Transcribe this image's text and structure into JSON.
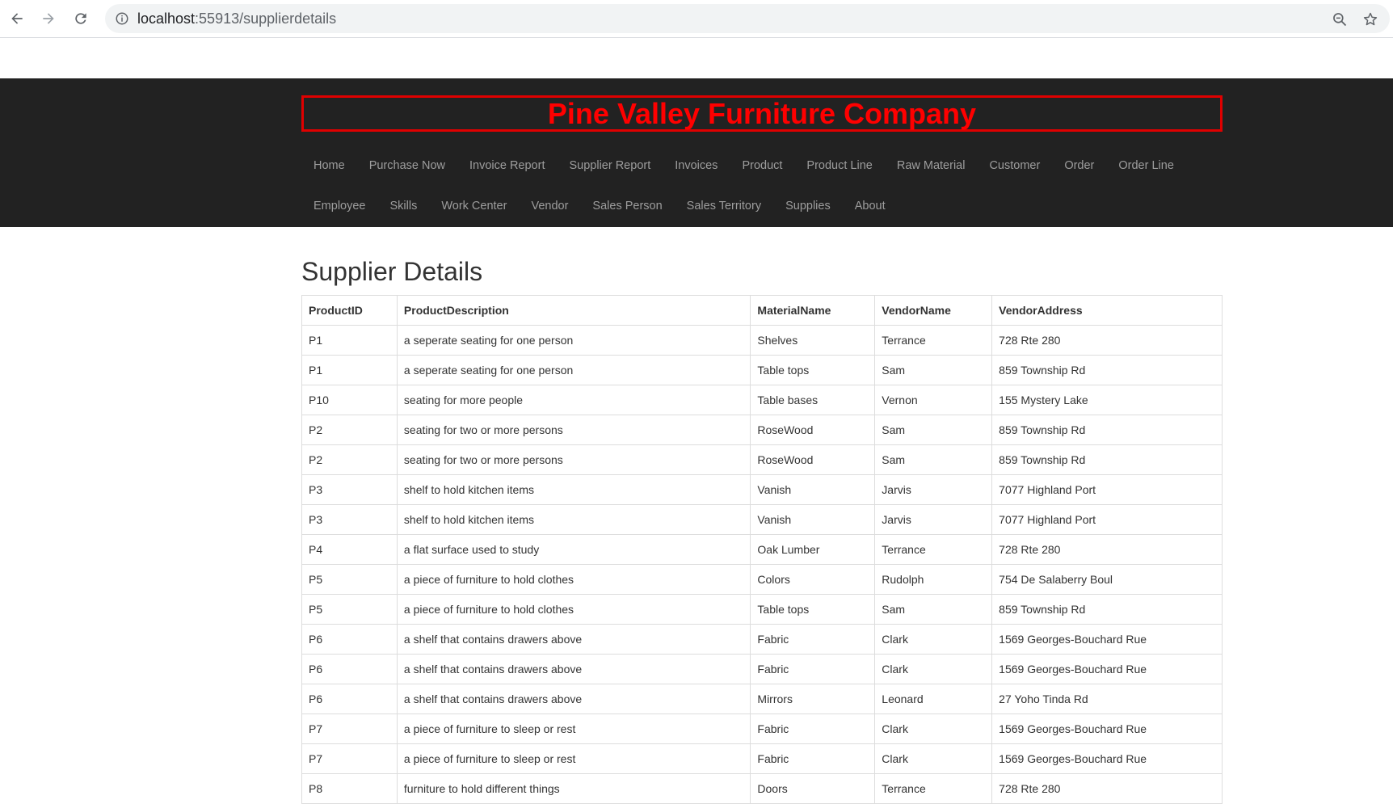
{
  "browser": {
    "url_host": "localhost",
    "url_rest": ":55913/supplierdetails"
  },
  "header": {
    "brand": "Pine Valley Furniture Company",
    "nav_row1": [
      "Home",
      "Purchase Now",
      "Invoice Report",
      "Supplier Report",
      "Invoices",
      "Product",
      "Product Line",
      "Raw Material",
      "Customer",
      "Order",
      "Order Line"
    ],
    "nav_row2": [
      "Employee",
      "Skills",
      "Work Center",
      "Vendor",
      "Sales Person",
      "Sales Territory",
      "Supplies",
      "About"
    ]
  },
  "main": {
    "title": "Supplier Details",
    "columns": [
      "ProductID",
      "ProductDescription",
      "MaterialName",
      "VendorName",
      "VendorAddress"
    ],
    "rows": [
      [
        "P1",
        "a seperate seating for one person",
        "Shelves",
        "Terrance",
        "728 Rte 280"
      ],
      [
        "P1",
        "a seperate seating for one person",
        "Table tops",
        "Sam",
        "859 Township Rd"
      ],
      [
        "P10",
        "seating for more people",
        "Table bases",
        "Vernon",
        "155 Mystery Lake"
      ],
      [
        "P2",
        "seating for two or more persons",
        "RoseWood",
        "Sam",
        "859 Township Rd"
      ],
      [
        "P2",
        "seating for two or more persons",
        "RoseWood",
        "Sam",
        "859 Township Rd"
      ],
      [
        "P3",
        "shelf to hold kitchen items",
        "Vanish",
        "Jarvis",
        "7077 Highland Port"
      ],
      [
        "P3",
        "shelf to hold kitchen items",
        "Vanish",
        "Jarvis",
        "7077 Highland Port"
      ],
      [
        "P4",
        "a flat surface used to study",
        "Oak Lumber",
        "Terrance",
        "728 Rte 280"
      ],
      [
        "P5",
        "a piece of furniture to hold clothes",
        "Colors",
        "Rudolph",
        "754 De Salaberry Boul"
      ],
      [
        "P5",
        "a piece of furniture to hold clothes",
        "Table tops",
        "Sam",
        "859 Township Rd"
      ],
      [
        "P6",
        "a shelf that contains drawers above",
        "Fabric",
        "Clark",
        "1569 Georges-Bouchard Rue"
      ],
      [
        "P6",
        "a shelf that contains drawers above",
        "Fabric",
        "Clark",
        "1569 Georges-Bouchard Rue"
      ],
      [
        "P6",
        "a shelf that contains drawers above",
        "Mirrors",
        "Leonard",
        "27 Yoho Tinda Rd"
      ],
      [
        "P7",
        "a piece of furniture to sleep or rest",
        "Fabric",
        "Clark",
        "1569 Georges-Bouchard Rue"
      ],
      [
        "P7",
        "a piece of furniture to sleep or rest",
        "Fabric",
        "Clark",
        "1569 Georges-Bouchard Rue"
      ],
      [
        "P8",
        "furniture to hold different things",
        "Doors",
        "Terrance",
        "728 Rte 280"
      ]
    ]
  }
}
